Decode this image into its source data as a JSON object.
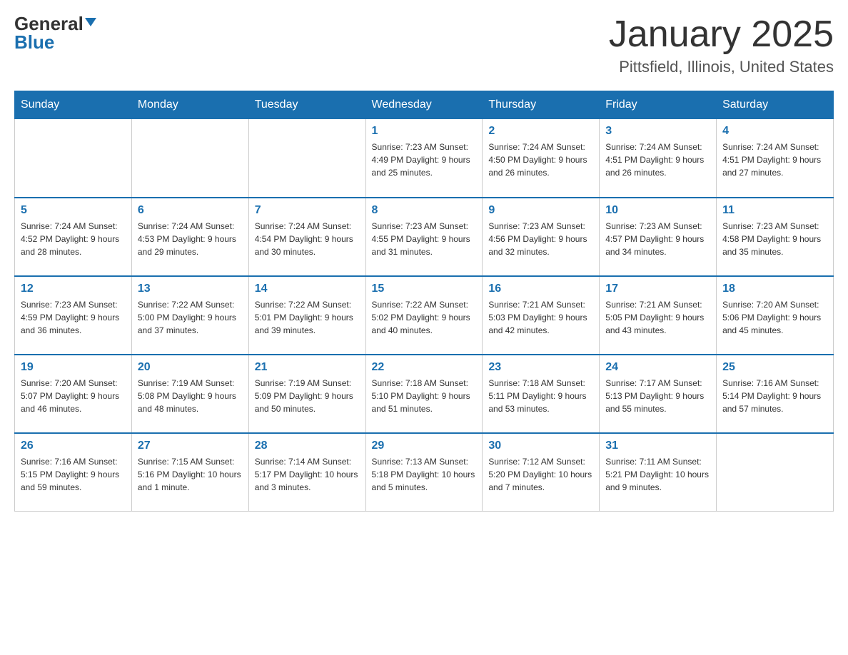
{
  "header": {
    "logo_general": "General",
    "logo_blue": "Blue",
    "title": "January 2025",
    "subtitle": "Pittsfield, Illinois, United States"
  },
  "weekdays": [
    "Sunday",
    "Monday",
    "Tuesday",
    "Wednesday",
    "Thursday",
    "Friday",
    "Saturday"
  ],
  "weeks": [
    [
      {
        "day": "",
        "info": ""
      },
      {
        "day": "",
        "info": ""
      },
      {
        "day": "",
        "info": ""
      },
      {
        "day": "1",
        "info": "Sunrise: 7:23 AM\nSunset: 4:49 PM\nDaylight: 9 hours\nand 25 minutes."
      },
      {
        "day": "2",
        "info": "Sunrise: 7:24 AM\nSunset: 4:50 PM\nDaylight: 9 hours\nand 26 minutes."
      },
      {
        "day": "3",
        "info": "Sunrise: 7:24 AM\nSunset: 4:51 PM\nDaylight: 9 hours\nand 26 minutes."
      },
      {
        "day": "4",
        "info": "Sunrise: 7:24 AM\nSunset: 4:51 PM\nDaylight: 9 hours\nand 27 minutes."
      }
    ],
    [
      {
        "day": "5",
        "info": "Sunrise: 7:24 AM\nSunset: 4:52 PM\nDaylight: 9 hours\nand 28 minutes."
      },
      {
        "day": "6",
        "info": "Sunrise: 7:24 AM\nSunset: 4:53 PM\nDaylight: 9 hours\nand 29 minutes."
      },
      {
        "day": "7",
        "info": "Sunrise: 7:24 AM\nSunset: 4:54 PM\nDaylight: 9 hours\nand 30 minutes."
      },
      {
        "day": "8",
        "info": "Sunrise: 7:23 AM\nSunset: 4:55 PM\nDaylight: 9 hours\nand 31 minutes."
      },
      {
        "day": "9",
        "info": "Sunrise: 7:23 AM\nSunset: 4:56 PM\nDaylight: 9 hours\nand 32 minutes."
      },
      {
        "day": "10",
        "info": "Sunrise: 7:23 AM\nSunset: 4:57 PM\nDaylight: 9 hours\nand 34 minutes."
      },
      {
        "day": "11",
        "info": "Sunrise: 7:23 AM\nSunset: 4:58 PM\nDaylight: 9 hours\nand 35 minutes."
      }
    ],
    [
      {
        "day": "12",
        "info": "Sunrise: 7:23 AM\nSunset: 4:59 PM\nDaylight: 9 hours\nand 36 minutes."
      },
      {
        "day": "13",
        "info": "Sunrise: 7:22 AM\nSunset: 5:00 PM\nDaylight: 9 hours\nand 37 minutes."
      },
      {
        "day": "14",
        "info": "Sunrise: 7:22 AM\nSunset: 5:01 PM\nDaylight: 9 hours\nand 39 minutes."
      },
      {
        "day": "15",
        "info": "Sunrise: 7:22 AM\nSunset: 5:02 PM\nDaylight: 9 hours\nand 40 minutes."
      },
      {
        "day": "16",
        "info": "Sunrise: 7:21 AM\nSunset: 5:03 PM\nDaylight: 9 hours\nand 42 minutes."
      },
      {
        "day": "17",
        "info": "Sunrise: 7:21 AM\nSunset: 5:05 PM\nDaylight: 9 hours\nand 43 minutes."
      },
      {
        "day": "18",
        "info": "Sunrise: 7:20 AM\nSunset: 5:06 PM\nDaylight: 9 hours\nand 45 minutes."
      }
    ],
    [
      {
        "day": "19",
        "info": "Sunrise: 7:20 AM\nSunset: 5:07 PM\nDaylight: 9 hours\nand 46 minutes."
      },
      {
        "day": "20",
        "info": "Sunrise: 7:19 AM\nSunset: 5:08 PM\nDaylight: 9 hours\nand 48 minutes."
      },
      {
        "day": "21",
        "info": "Sunrise: 7:19 AM\nSunset: 5:09 PM\nDaylight: 9 hours\nand 50 minutes."
      },
      {
        "day": "22",
        "info": "Sunrise: 7:18 AM\nSunset: 5:10 PM\nDaylight: 9 hours\nand 51 minutes."
      },
      {
        "day": "23",
        "info": "Sunrise: 7:18 AM\nSunset: 5:11 PM\nDaylight: 9 hours\nand 53 minutes."
      },
      {
        "day": "24",
        "info": "Sunrise: 7:17 AM\nSunset: 5:13 PM\nDaylight: 9 hours\nand 55 minutes."
      },
      {
        "day": "25",
        "info": "Sunrise: 7:16 AM\nSunset: 5:14 PM\nDaylight: 9 hours\nand 57 minutes."
      }
    ],
    [
      {
        "day": "26",
        "info": "Sunrise: 7:16 AM\nSunset: 5:15 PM\nDaylight: 9 hours\nand 59 minutes."
      },
      {
        "day": "27",
        "info": "Sunrise: 7:15 AM\nSunset: 5:16 PM\nDaylight: 10 hours\nand 1 minute."
      },
      {
        "day": "28",
        "info": "Sunrise: 7:14 AM\nSunset: 5:17 PM\nDaylight: 10 hours\nand 3 minutes."
      },
      {
        "day": "29",
        "info": "Sunrise: 7:13 AM\nSunset: 5:18 PM\nDaylight: 10 hours\nand 5 minutes."
      },
      {
        "day": "30",
        "info": "Sunrise: 7:12 AM\nSunset: 5:20 PM\nDaylight: 10 hours\nand 7 minutes."
      },
      {
        "day": "31",
        "info": "Sunrise: 7:11 AM\nSunset: 5:21 PM\nDaylight: 10 hours\nand 9 minutes."
      },
      {
        "day": "",
        "info": ""
      }
    ]
  ]
}
